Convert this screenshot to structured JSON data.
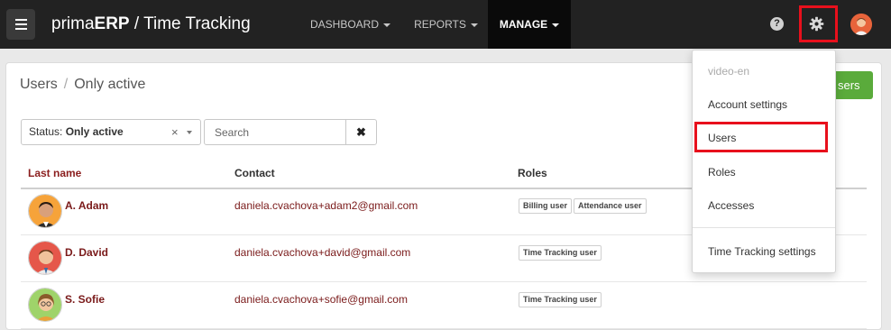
{
  "header": {
    "brand_prefix": "prima",
    "brand_bold": "ERP",
    "brand_suffix": " / Time Tracking",
    "nav": [
      {
        "label": "DASHBOARD"
      },
      {
        "label": "REPORTS"
      },
      {
        "label": "MANAGE"
      }
    ],
    "help_glyph": "?",
    "icons": [
      "menu-icon",
      "help-icon",
      "gear-icon",
      "avatar"
    ],
    "accent_highlight": "#e8101c"
  },
  "page": {
    "breadcrumb_root": "Users",
    "breadcrumb_separator": "/",
    "breadcrumb_current": "Only active",
    "add_button_label": "sers",
    "add_button_color": "#5aab3b"
  },
  "filters": {
    "status_prefix": "Status: ",
    "status_value": "Only active",
    "status_clear": "×",
    "search_placeholder": "Search",
    "search_clear": "✖"
  },
  "table": {
    "columns": [
      "Last name",
      "Contact",
      "Roles"
    ],
    "rows": [
      {
        "name": "A. Adam",
        "email": "daniela.cvachova+adam2@gmail.com",
        "roles": [
          "Billing user",
          "Attendance user"
        ]
      },
      {
        "name": "D. David",
        "email": "daniela.cvachova+david@gmail.com",
        "roles": [
          "Time Tracking user"
        ]
      },
      {
        "name": "S. Sofie",
        "email": "daniela.cvachova+sofie@gmail.com",
        "roles": [
          "Time Tracking user"
        ]
      }
    ]
  },
  "dropdown": {
    "header": "video-en",
    "items": [
      "Account settings",
      "Users",
      "Roles",
      "Accesses"
    ],
    "footer_item": "Time Tracking settings",
    "selected": "Users"
  }
}
